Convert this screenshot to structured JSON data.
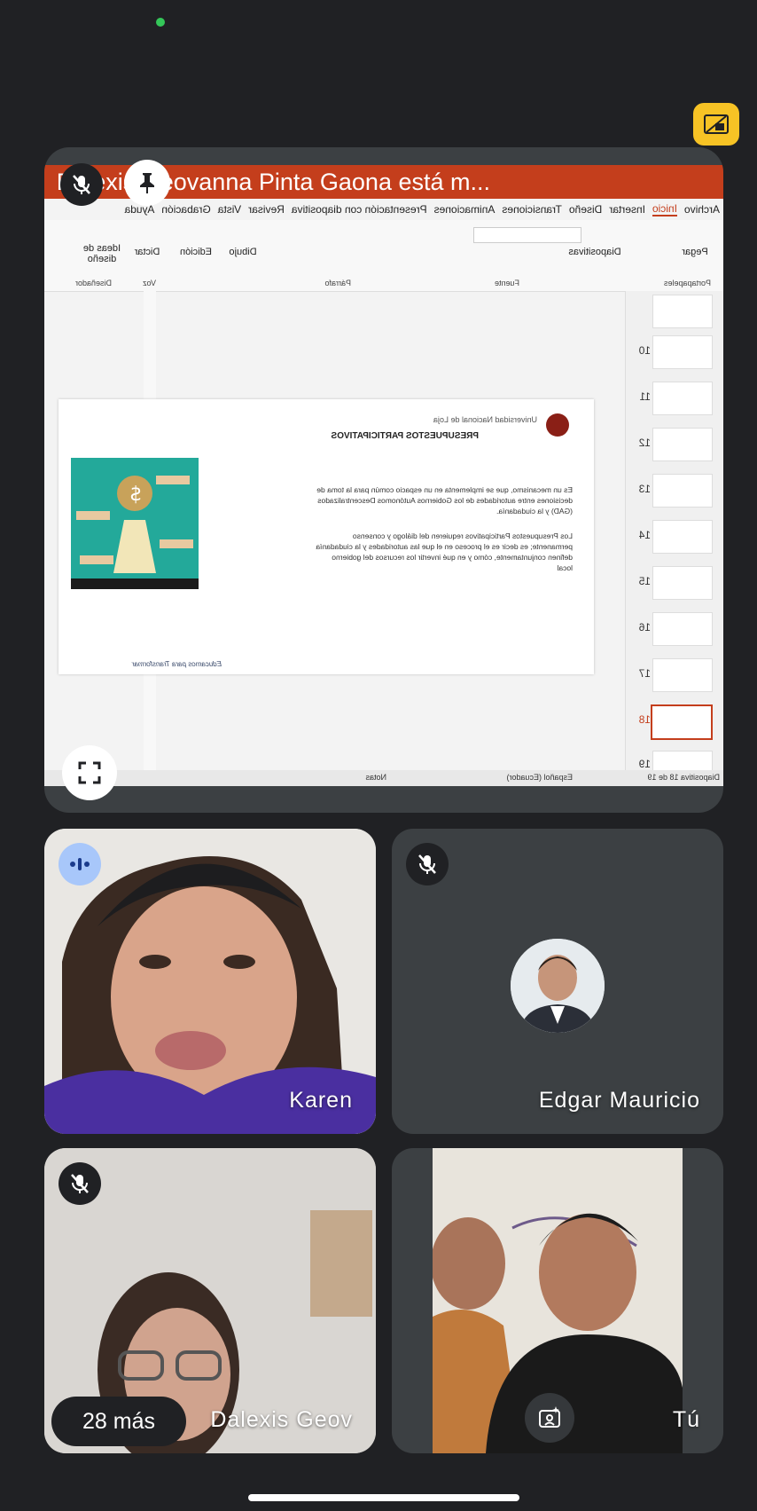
{
  "presenter_banner": "Dalexis Geovanna Pinta Gaona está m...",
  "ppt": {
    "tabs": [
      "Archivo",
      "Inicio",
      "Insertar",
      "Diseño",
      "Transiciones",
      "Animaciones",
      "Presentación con diapositiva",
      "Revisar",
      "Vista",
      "Grabación",
      "Ayuda"
    ],
    "active_tab": "Inicio",
    "buttons": [
      "Pegar",
      "Diapositivas",
      "Dibujo",
      "Edición",
      "Dictar",
      "Ideas de diseño"
    ],
    "groups": [
      "Portapapeles",
      "Fuente",
      "Párrafo",
      "Voz",
      "Diseñador"
    ],
    "thumb_numbers": [
      "10",
      "11",
      "12",
      "13",
      "14",
      "15",
      "16",
      "17",
      "18",
      "19"
    ],
    "selected_slide": "18",
    "slide": {
      "title": "PRESUPUESTOS PARTICIPATIVOS",
      "university": "Universidad Nacional de Loja",
      "para1": "Es un mecanismo, que se implementa en un espacio común para la toma de decisiones entre autoridades de los Gobiernos Autónomos Descentralizados (GAD) y la ciudadanía.",
      "para2": "Los Presupuestos Participativos requieren del diálogo y consenso permanente; es decir es el proceso en el que las autoridades y la ciudadanía definen conjuntamente, cómo y en qué invertir los recursos del gobierno local",
      "footer": "Educamos para Transformar"
    },
    "status": {
      "slide_count": "Diapositiva 18 de 19",
      "language": "Español (Ecuador)",
      "notes": "Notas"
    }
  },
  "participants": [
    {
      "name": "Karen"
    },
    {
      "name": "Edgar Mauricio"
    },
    {
      "name": "Dalexis Geov"
    },
    {
      "name": "Tú"
    }
  ],
  "more_label": "28 más",
  "colors": {
    "background": "#202124",
    "tile": "#3c4043",
    "accent": "#f7c325",
    "speaking": "#a8c7fa",
    "ppt_red": "#c43e1c"
  },
  "icons": {
    "muted": "mic-off-icon",
    "pin": "pin-icon",
    "fullscreen": "fullscreen-icon",
    "speaking": "audio-wave-icon",
    "layout": "layout-icon",
    "effects": "effects-icon"
  }
}
